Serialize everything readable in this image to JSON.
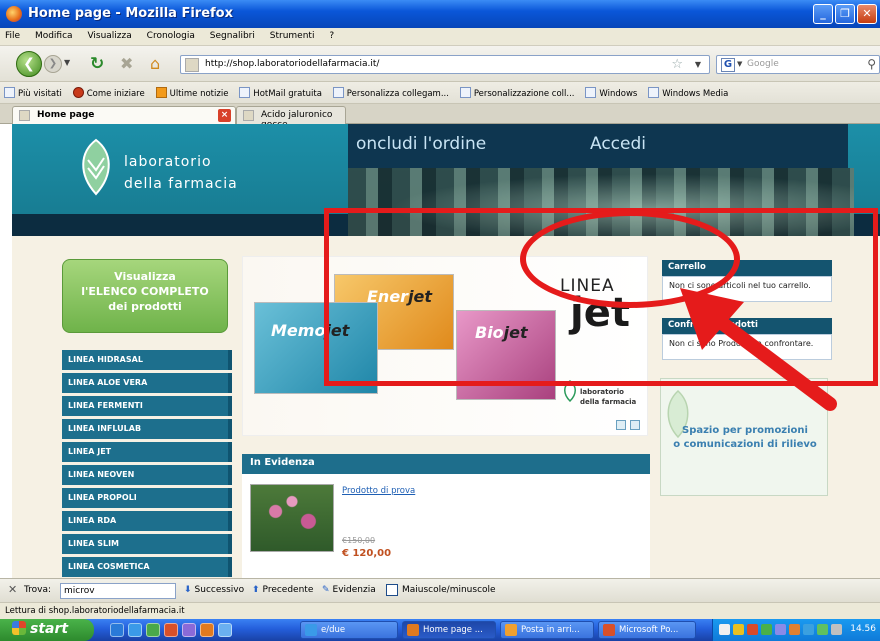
{
  "window": {
    "title": "Home page - Mozilla Firefox",
    "min_label": "_",
    "max_label": "❐",
    "close_label": "✕"
  },
  "menu": [
    "File",
    "Modifica",
    "Visualizza",
    "Cronologia",
    "Segnalibri",
    "Strumenti",
    "?"
  ],
  "navbar": {
    "url": "http://shop.laboratoriodellafarmacia.it/",
    "search_placeholder": "Google"
  },
  "bookmarks": [
    {
      "label": "Più visitati",
      "icon": "folder"
    },
    {
      "label": "Come iniziare",
      "icon": "firefox"
    },
    {
      "label": "Ultime notizie",
      "icon": "rss"
    },
    {
      "label": "HotMail gratuita",
      "icon": "page"
    },
    {
      "label": "Personalizza collegam...",
      "icon": "page"
    },
    {
      "label": "Personalizzazione coll...",
      "icon": "page"
    },
    {
      "label": "Windows",
      "icon": "page"
    },
    {
      "label": "Windows Media",
      "icon": "page"
    }
  ],
  "tabs": [
    {
      "label": "Home page",
      "active": true
    },
    {
      "label": "Acido jaluronico gocce",
      "active": false
    }
  ],
  "site": {
    "logo_line1": "laboratorio",
    "logo_line2": "della farmacia",
    "nav_concludi": "oncludi l'ordine",
    "nav_accedi": "Accedi",
    "elenco_line1": "Visualizza",
    "elenco_line2": "l'ELENCO COMPLETO",
    "elenco_line3": "dei prodotti",
    "categories": [
      "LINEA HIDRASAL",
      "LINEA ALOE VERA",
      "LINEA FERMENTI",
      "LINEA INFLULAB",
      "LINEA JET",
      "LINEA NEOVEN",
      "LINEA PROPOLI",
      "LINEA RDA",
      "LINEA SLIM",
      "LINEA COSMETICA"
    ],
    "banner": {
      "linea": "LINEA",
      "jet": "jet",
      "box_energ": "Ener",
      "box_memo": "Memo",
      "box_bio": "Bio",
      "box_jet_word": "jet",
      "mini_line1": "laboratorio",
      "mini_line2": "della farmacia"
    },
    "evidenza": {
      "title": "In Evidenza",
      "product_link": "Prodotto di prova",
      "old_price": "€150,00",
      "price": "€ 120,00"
    },
    "carrello": {
      "title": "Carrello",
      "body": "Non ci sono articoli nel tuo carrello."
    },
    "confronta": {
      "title": "Confronta Prodotti",
      "body": "Non ci sono Prodotti da confrontare."
    },
    "promo": {
      "line1": "Spazio per promozioni",
      "line2": "o comunicazioni di rilievo"
    }
  },
  "findbar": {
    "label": "Trova:",
    "value": "microv",
    "next": "Successivo",
    "prev": "Precedente",
    "highlight": "Evidenzia",
    "matchcase": "Maiuscole/minuscole"
  },
  "status": "Lettura di shop.laboratoriodellafarmacia.it",
  "taskbar": {
    "start": "start",
    "buttons": [
      {
        "label": "e/due",
        "icon": "ie"
      },
      {
        "label": "Home page ...",
        "icon": "firefox",
        "active": true
      },
      {
        "label": "Posta in arri...",
        "icon": "outlook"
      },
      {
        "label": "Microsoft Po...",
        "icon": "powerpoint"
      }
    ],
    "clock": "14.56"
  },
  "colors": {
    "accent_red": "#e51b1b",
    "site_teal": "#1d6f8d",
    "elenco_green": "#6fb34a"
  }
}
